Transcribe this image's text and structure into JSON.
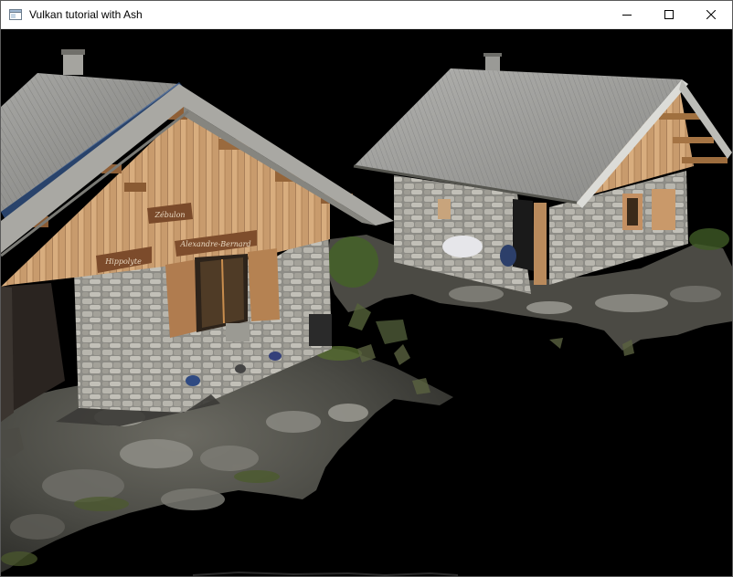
{
  "window": {
    "title": "Vulkan tutorial with Ash",
    "app_icon": "window-app-icon"
  },
  "controls": {
    "minimize_icon": "minimize-icon",
    "maximize_icon": "maximize-icon",
    "close_icon": "close-icon"
  },
  "scene": {
    "description_name": "3d-render-viewport",
    "clear_color": "#000000",
    "signs": {
      "sign_top": "Zébulon",
      "sign_left": "Hippolyte",
      "sign_right": "Alexandre-Bernard"
    }
  }
}
